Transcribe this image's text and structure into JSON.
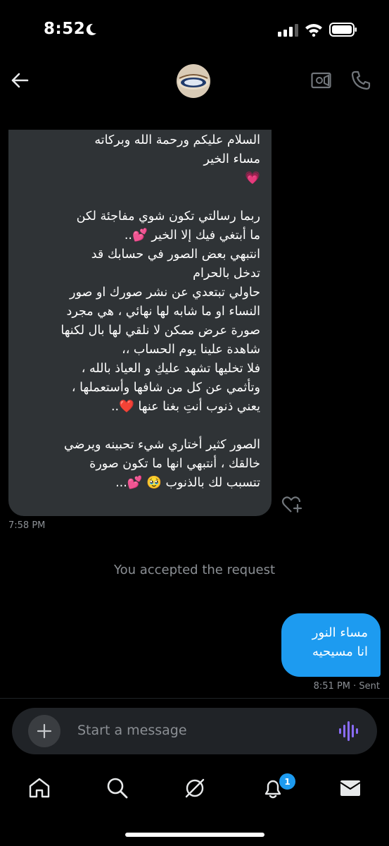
{
  "status_bar": {
    "time": "8:52"
  },
  "header": {
    "avatar": "avatar"
  },
  "messages": {
    "incoming": {
      "text": "السلام عليكم ورحمة الله وبركاته\nمساء الخير\n💗\n\nربما رسالتي تكون شوي مفاجئة لكن\nما أبتغي فيك إلا الخير 💕..\nانتبهي بعض الصور في حسابك قد\nتدخل بالحرام\nحاولي تبتعدي عن نشر صورك او صور\nالنساء  او ما شابه لها نهائي ،  هي مجرد\nصورة عرض ممكن لا نلقي لها بال لكنها\nشاهدة علينا يوم الحساب ،،\nفلا تخليها تشهد عليكِ و العياذ بالله ،\nوتأثمي عن كل من شافها وأستعملها ،\nيعني ذنوب أنتِ بغنا عنها ❤️..\n\nالصور كثير أختاري شيء تحبينه ويرضي\nخالقك ، أنتبهي انها ما تكون صورة\nتتسبب لك بالذنوب 🥹 💕...",
      "timestamp": "7:58 PM"
    },
    "system": "You accepted the request",
    "outgoing": {
      "text": "مساء النور\nانا مسيحيه",
      "timestamp": "8:51 PM · Sent"
    }
  },
  "composer": {
    "placeholder": "Start a message"
  },
  "nav": {
    "items": [
      "home",
      "search",
      "grok",
      "notifications",
      "messages"
    ],
    "notification_count": "1"
  },
  "colors": {
    "accent": "#1d9bf0",
    "bubble_in": "#2f3336",
    "composer": "#202327"
  }
}
